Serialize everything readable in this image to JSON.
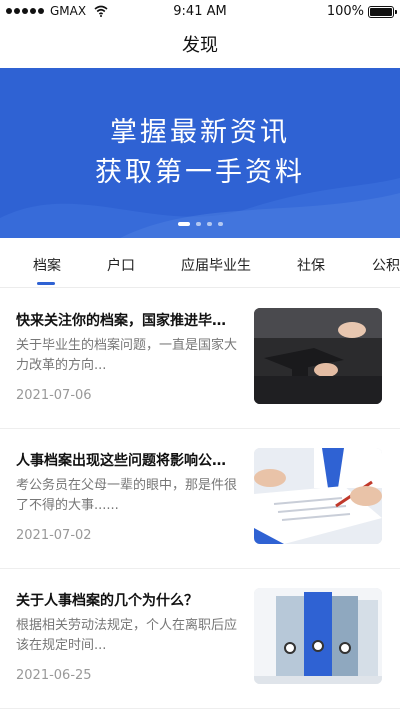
{
  "status_bar": {
    "carrier": "GMAX",
    "time": "9:41 AM",
    "battery": "100%",
    "battery_level": 1.0
  },
  "nav": {
    "title": "发现"
  },
  "banner": {
    "line1": "掌握最新资讯",
    "line2": "获取第一手资料",
    "slide_count": 4,
    "active_slide": 1
  },
  "tabs": [
    "档案",
    "户口",
    "应届毕业生",
    "社保",
    "公积"
  ],
  "active_tab": 0,
  "news": [
    {
      "title": "快来关注你的档案，国家推进毕…",
      "summary": "关于毕业生的档案问题，一直是国家大力改革的方向...",
      "date": "2021-07-06"
    },
    {
      "title": "人事档案出现这些问题将影响公…",
      "summary": "考公务员在父母一辈的眼中，那是件很了不得的大事......",
      "date": "2021-07-02"
    },
    {
      "title": "关于人事档案的几个为什么？",
      "summary": "根据相关劳动法规定，个人在离职后应该在规定时间...",
      "date": "2021-06-25"
    }
  ]
}
